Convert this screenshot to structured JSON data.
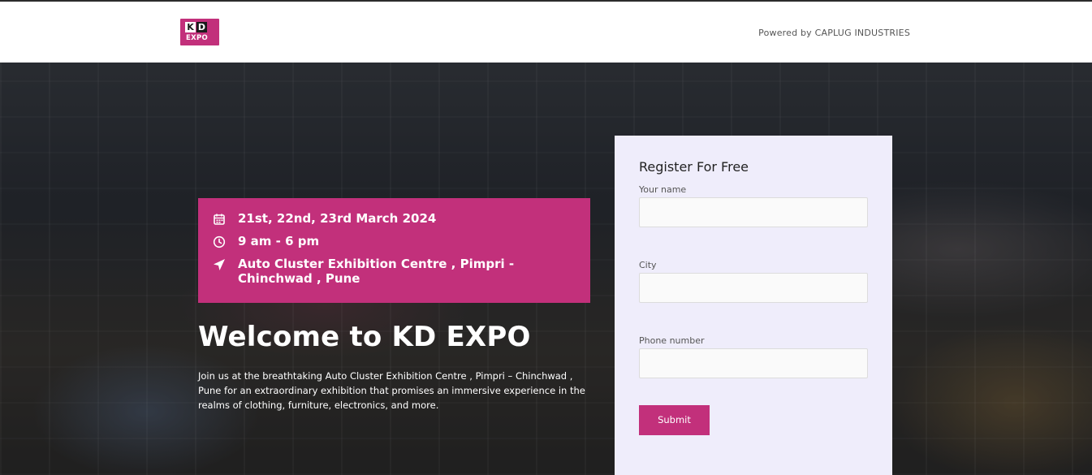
{
  "header": {
    "logo": {
      "letter1": "K",
      "letter2": "D",
      "sub": "EXPO"
    },
    "powered_by": "Powered by CAPLUG INDUSTRIES"
  },
  "info": {
    "dates": "21st, 22nd, 23rd March 2024",
    "time": "9 am - 6 pm",
    "location": "Auto Cluster Exhibition Centre , Pimpri - Chinchwad , Pune"
  },
  "hero": {
    "title": "Welcome to KD EXPO",
    "description": "Join us at the breathtaking Auto Cluster Exhibition Centre , Pimpri – Chinchwad , Pune for an extraordinary exhibition that promises an immersive experience in the realms of clothing, furniture, electronics, and more."
  },
  "form": {
    "title": "Register For Free",
    "name_label": "Your name",
    "city_label": "City",
    "phone_label": "Phone number",
    "submit_label": "Submit"
  },
  "colors": {
    "accent": "#c2307b",
    "form_bg": "#efedfb"
  }
}
